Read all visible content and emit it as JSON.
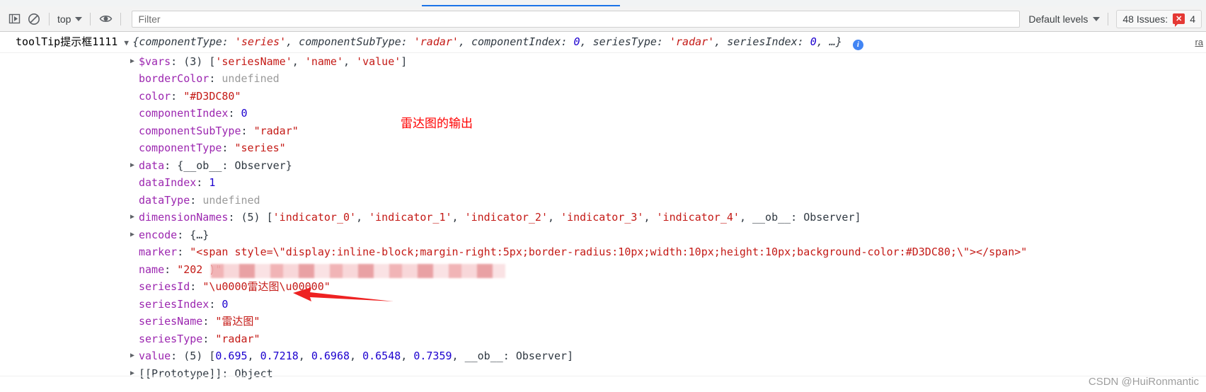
{
  "toolbar": {
    "execute_icon": "step-into-icon",
    "clear_icon": "clear-console-icon",
    "context_label": "top",
    "eye_icon": "live-expression-icon",
    "filter_placeholder": "Filter",
    "filter_value": "",
    "levels_label": "Default levels",
    "issues_label": "48 Issues:",
    "issues_error_count": "4",
    "issue_badge_glyph": "✕"
  },
  "console": {
    "message_label": "toolTip提示框1111",
    "toggle_glyph": "▼",
    "object_preview": "{componentType: 'series', componentSubType: 'radar', componentIndex: 0, seriesType: 'radar', seriesIndex: 0, …}",
    "preview_parts": [
      {
        "text": "{",
        "cls": "punc"
      },
      {
        "text": "componentType: ",
        "cls": "pn"
      },
      {
        "text": "'series'",
        "cls": "str"
      },
      {
        "text": ", componentSubType: ",
        "cls": "pn"
      },
      {
        "text": "'radar'",
        "cls": "str"
      },
      {
        "text": ", componentIndex: ",
        "cls": "pn"
      },
      {
        "text": "0",
        "cls": "num"
      },
      {
        "text": ", seriesType: ",
        "cls": "pn"
      },
      {
        "text": "'radar'",
        "cls": "str"
      },
      {
        "text": ", seriesIndex: ",
        "cls": "pn"
      },
      {
        "text": "0",
        "cls": "num"
      },
      {
        "text": ", …}",
        "cls": "punc"
      }
    ],
    "info_icon_glyph": "i",
    "properties": [
      {
        "expandable": true,
        "key": "$vars",
        "value_parts": [
          {
            "text": "(3) [",
            "cls": "pn"
          },
          {
            "text": "'seriesName'",
            "cls": "str"
          },
          {
            "text": ", ",
            "cls": "pn"
          },
          {
            "text": "'name'",
            "cls": "str"
          },
          {
            "text": ", ",
            "cls": "pn"
          },
          {
            "text": "'value'",
            "cls": "str"
          },
          {
            "text": "]",
            "cls": "pn"
          }
        ]
      },
      {
        "expandable": false,
        "key": "borderColor",
        "value_parts": [
          {
            "text": "undefined",
            "cls": "und"
          }
        ]
      },
      {
        "expandable": false,
        "key": "color",
        "value_parts": [
          {
            "text": "\"#D3DC80\"",
            "cls": "str"
          }
        ]
      },
      {
        "expandable": false,
        "key": "componentIndex",
        "value_parts": [
          {
            "text": "0",
            "cls": "num"
          }
        ]
      },
      {
        "expandable": false,
        "key": "componentSubType",
        "value_parts": [
          {
            "text": "\"radar\"",
            "cls": "str"
          }
        ]
      },
      {
        "expandable": false,
        "key": "componentType",
        "value_parts": [
          {
            "text": "\"series\"",
            "cls": "str"
          }
        ]
      },
      {
        "expandable": true,
        "key": "data",
        "value_parts": [
          {
            "text": "{__ob__: Observer}",
            "cls": "pn"
          }
        ]
      },
      {
        "expandable": false,
        "key": "dataIndex",
        "value_parts": [
          {
            "text": "1",
            "cls": "num"
          }
        ]
      },
      {
        "expandable": false,
        "key": "dataType",
        "value_parts": [
          {
            "text": "undefined",
            "cls": "und"
          }
        ]
      },
      {
        "expandable": true,
        "key": "dimensionNames",
        "value_parts": [
          {
            "text": "(5) [",
            "cls": "pn"
          },
          {
            "text": "'indicator_0'",
            "cls": "str"
          },
          {
            "text": ", ",
            "cls": "pn"
          },
          {
            "text": "'indicator_1'",
            "cls": "str"
          },
          {
            "text": ", ",
            "cls": "pn"
          },
          {
            "text": "'indicator_2'",
            "cls": "str"
          },
          {
            "text": ", ",
            "cls": "pn"
          },
          {
            "text": "'indicator_3'",
            "cls": "str"
          },
          {
            "text": ", ",
            "cls": "pn"
          },
          {
            "text": "'indicator_4'",
            "cls": "str"
          },
          {
            "text": ", __ob__: Observer]",
            "cls": "pn"
          }
        ]
      },
      {
        "expandable": true,
        "key": "encode",
        "value_parts": [
          {
            "text": "{…}",
            "cls": "pn"
          }
        ]
      },
      {
        "expandable": false,
        "key": "marker",
        "value_parts": [
          {
            "text": "\"<span style=\\\"display:inline-block;margin-right:5px;border-radius:10px;width:10px;height:10px;background-color:#D3DC80;\\\"></span>\"",
            "cls": "str"
          }
        ]
      },
      {
        "expandable": false,
        "key": "name",
        "redacted": true,
        "value_parts": [
          {
            "text": "\"202",
            "cls": "str"
          },
          {
            "text": "                                                              ",
            "cls": "str"
          },
          {
            "text": ")\"",
            "cls": "str"
          }
        ]
      },
      {
        "expandable": false,
        "key": "seriesId",
        "value_parts": [
          {
            "text": "\"\\u0000雷达图\\u00000\"",
            "cls": "str"
          }
        ]
      },
      {
        "expandable": false,
        "key": "seriesIndex",
        "value_parts": [
          {
            "text": "0",
            "cls": "num"
          }
        ]
      },
      {
        "expandable": false,
        "key": "seriesName",
        "value_parts": [
          {
            "text": "\"雷达图\"",
            "cls": "str"
          }
        ]
      },
      {
        "expandable": false,
        "key": "seriesType",
        "value_parts": [
          {
            "text": "\"radar\"",
            "cls": "str"
          }
        ]
      },
      {
        "expandable": true,
        "key": "value",
        "value_parts": [
          {
            "text": "(5) [",
            "cls": "pn"
          },
          {
            "text": "0.695",
            "cls": "num"
          },
          {
            "text": ", ",
            "cls": "pn"
          },
          {
            "text": "0.7218",
            "cls": "num"
          },
          {
            "text": ", ",
            "cls": "pn"
          },
          {
            "text": "0.6968",
            "cls": "num"
          },
          {
            "text": ", ",
            "cls": "pn"
          },
          {
            "text": "0.6548",
            "cls": "num"
          },
          {
            "text": ", ",
            "cls": "pn"
          },
          {
            "text": "0.7359",
            "cls": "num"
          },
          {
            "text": ", __ob__: Observer]",
            "cls": "pn"
          }
        ]
      },
      {
        "expandable": true,
        "key": "[[Prototype]]",
        "proto": true,
        "value_parts": [
          {
            "text": "Object",
            "cls": "pn"
          }
        ]
      }
    ]
  },
  "annotations": {
    "note_text": "雷达图的输出",
    "note_color": "#ff0000",
    "arrow_color": "#ee2222",
    "arrow_target": "seriesName"
  },
  "misc": {
    "edge_link_text": "ra",
    "watermark": "CSDN @HuiRonmantic"
  }
}
